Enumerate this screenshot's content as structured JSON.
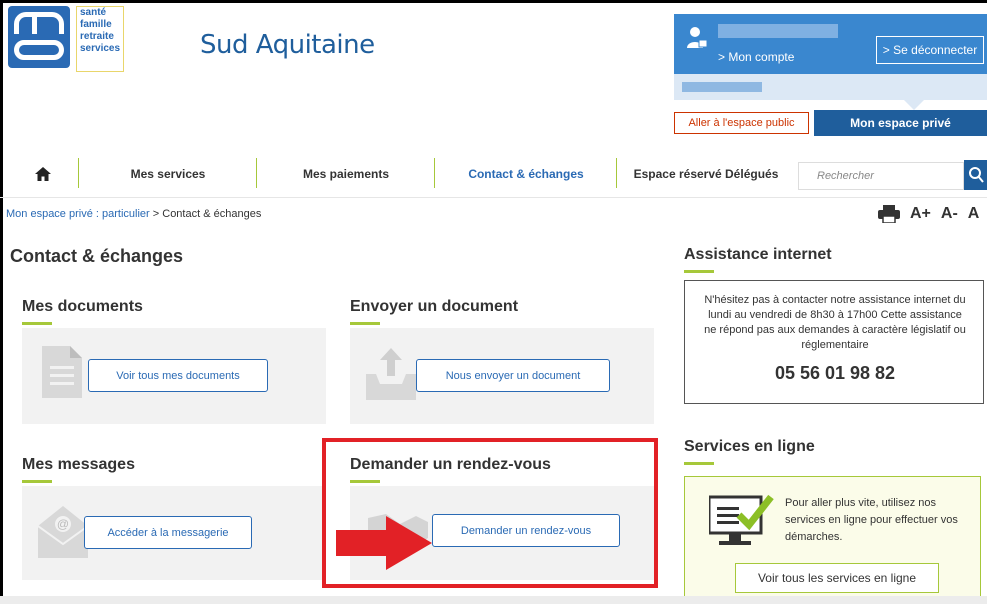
{
  "logo": {
    "lines": [
      "santé",
      "famille",
      "retraite",
      "services"
    ]
  },
  "brand": "Sud Aquitaine",
  "account": {
    "mon_compte": "> Mon compte",
    "logout": "> Se déconnecter"
  },
  "spaces": {
    "public": "Aller à l'espace public",
    "private": "Mon espace privé"
  },
  "nav": {
    "items": [
      "Mes services",
      "Mes paiements",
      "Contact & échanges",
      "Espace réservé Délégués"
    ],
    "search_placeholder": "Rechercher"
  },
  "breadcrumb": {
    "link": "Mon espace privé : particulier",
    "sep": ">",
    "current": "Contact & échanges"
  },
  "tools": {
    "a_plus": "A+",
    "a_minus": "A-",
    "a": "A"
  },
  "page_title": "Contact & échanges",
  "sections": {
    "docs": {
      "title": "Mes documents",
      "button": "Voir tous mes documents"
    },
    "send": {
      "title": "Envoyer un document",
      "button": "Nous envoyer un document"
    },
    "messages": {
      "title": "Mes messages",
      "button": "Accéder à la messagerie"
    },
    "rdv": {
      "title": "Demander un rendez-vous",
      "button": "Demander un rendez-vous"
    }
  },
  "assistance": {
    "title": "Assistance internet",
    "text": "N'hésitez pas à contacter notre assistance internet du lundi au vendredi de 8h30 à 17h00 Cette assistance ne répond pas aux demandes à caractère législatif ou réglementaire",
    "phone": "05 56 01 98 82"
  },
  "services_online": {
    "title": "Services en ligne",
    "text": "Pour aller plus vite, utilisez nos services en ligne pour effectuer vos démarches.",
    "button": "Voir tous les services en ligne"
  },
  "colors": {
    "blue": "#1f5e9c",
    "green": "#a6c83a",
    "red": "#e22126"
  }
}
